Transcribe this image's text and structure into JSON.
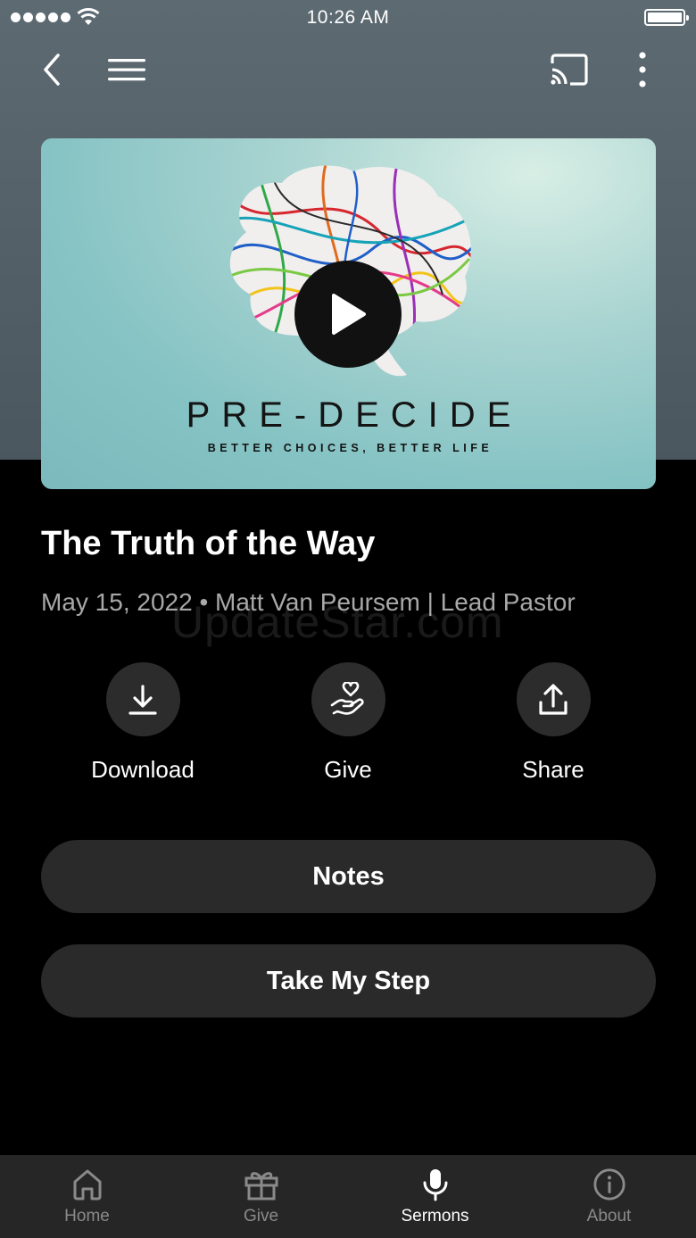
{
  "status_bar": {
    "time": "10:26 AM"
  },
  "nav": {
    "back_icon": "chevron-left-icon",
    "menu_icon": "hamburger-icon",
    "cast_icon": "cast-icon",
    "more_icon": "vertical-dots-icon"
  },
  "artwork": {
    "series_title": "PRE-DECIDE",
    "series_subtitle": "BETTER CHOICES, BETTER LIFE",
    "play_icon": "play-icon"
  },
  "sermon": {
    "title": "The Truth of the Way",
    "meta": "May 15, 2022 • Matt Van Peursem | Lead Pastor"
  },
  "watermark": "UpdateStar.com",
  "actions": [
    {
      "label": "Download",
      "icon": "download-icon"
    },
    {
      "label": "Give",
      "icon": "heart-hand-icon"
    },
    {
      "label": "Share",
      "icon": "share-icon"
    }
  ],
  "buttons": {
    "notes": "Notes",
    "take_step": "Take My Step"
  },
  "tabs": [
    {
      "label": "Home",
      "icon": "home-icon",
      "active": false
    },
    {
      "label": "Give",
      "icon": "gift-icon",
      "active": false
    },
    {
      "label": "Sermons",
      "icon": "microphone-icon",
      "active": true
    },
    {
      "label": "About",
      "icon": "info-icon",
      "active": false
    }
  ],
  "colors": {
    "header_bg": "#56636a",
    "page_bg": "#000000",
    "button_bg": "#2a2a2a",
    "tab_bar_bg": "#262626",
    "tab_inactive": "#8a8a8a"
  }
}
